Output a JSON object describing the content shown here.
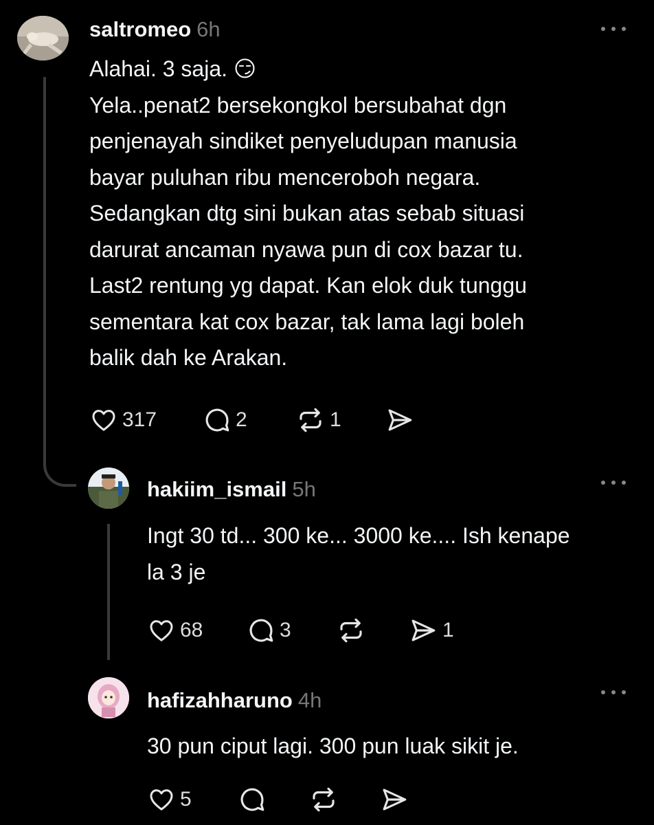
{
  "comments": [
    {
      "username": "saltromeo",
      "time": "6h",
      "lines": [
        "Alahai. 3 saja. 😏",
        "Yela..penat2 bersekongkol bersubahat dgn",
        "penjenayah sindiket penyeludupan manusia",
        "bayar puluhan ribu menceroboh negara.",
        "Sedangkan dtg sini bukan atas sebab situasi",
        "darurat ancaman nyawa pun di cox bazar tu.",
        "Last2 rentung yg dapat. Kan elok duk tunggu",
        "sementara kat cox bazar, tak lama lagi boleh",
        "balik dah ke Arakan."
      ],
      "likes": "317",
      "replies": "2",
      "reposts": "1",
      "shares": ""
    },
    {
      "username": "hakiim_ismail",
      "time": "5h",
      "lines": [
        "Ingt 30 td... 300 ke... 3000 ke.... Ish kenape",
        "la 3 je"
      ],
      "likes": "68",
      "replies": "3",
      "reposts": "",
      "shares": "1"
    },
    {
      "username": "hafizahharuno",
      "time": "4h",
      "lines": [
        "30 pun ciput lagi. 300 pun luak sikit je."
      ],
      "likes": "5",
      "replies": "",
      "reposts": "",
      "shares": ""
    }
  ],
  "icons": [
    "heart-icon",
    "comment-icon",
    "repost-icon",
    "share-icon",
    "more-icon"
  ],
  "colors": {
    "background": "#000000",
    "text": "#f3f5f7",
    "muted": "#777777",
    "thread_line": "#3a3a3a"
  }
}
